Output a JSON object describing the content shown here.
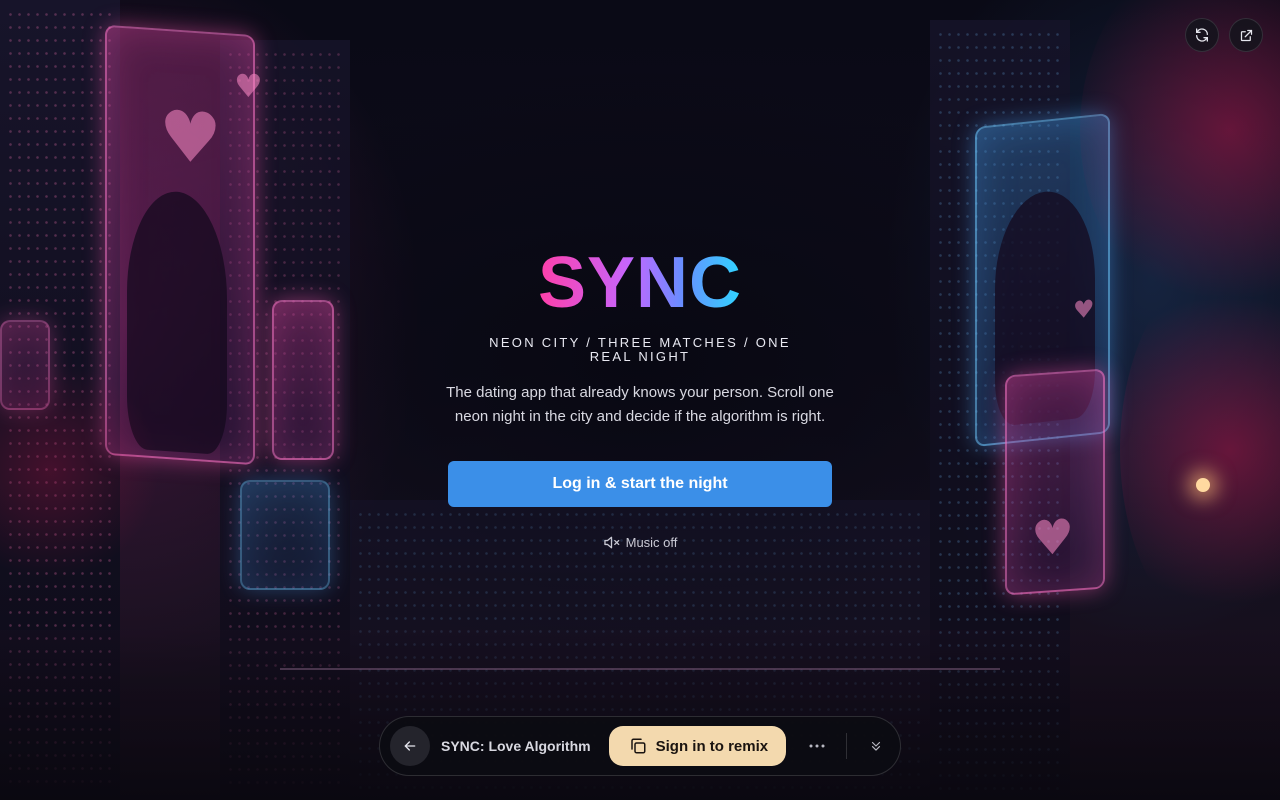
{
  "hero": {
    "logo": "SYNC",
    "tagline": "NEON CITY / THREE MATCHES / ONE REAL NIGHT",
    "description": "The dating app that already knows your person. Scroll one neon night in the city and decide if the algorithm is right.",
    "cta_label": "Log in & start the night",
    "music_label": "Music off"
  },
  "toolbar": {
    "refresh_icon": "refresh-icon",
    "open_external_icon": "external-link-icon"
  },
  "bottom_bar": {
    "back_icon": "arrow-left-icon",
    "title": "SYNC: Love Algorithm",
    "remix_label": "Sign in to remix",
    "remix_icon": "copy-icon",
    "more_icon": "ellipsis-icon",
    "collapse_icon": "chevrons-down-icon"
  },
  "colors": {
    "cta": "#3b8fe8",
    "remix": "#f3d9ae",
    "logo_gradient": [
      "#ff3fa8",
      "#c566ff",
      "#6a8cff",
      "#2fd6ff"
    ]
  }
}
